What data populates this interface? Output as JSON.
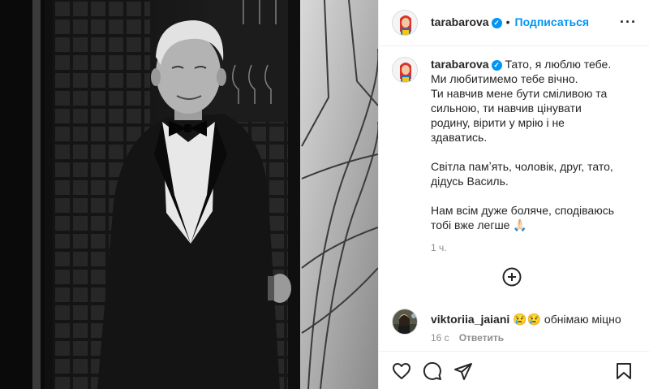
{
  "post": {
    "author": {
      "username": "tarabarova",
      "verified_mark": "✓",
      "follow_label": "Подписаться",
      "separator": "•",
      "more_label": "···"
    },
    "caption": {
      "paragraph_1": "Тато, я люблю тебе.\nМи любитимемо тебе вічно.\nТи навчив мене бути сміливою та\nсильною, ти навчив цінувати\nродину, вірити у мрію і не\nздаватись.",
      "paragraph_2": "Світла памʼять, чоловік, друг, тато,\nдідусь Василь.",
      "paragraph_3": "Нам всім дуже боляче, сподіваюсь\nтобі вже легше 🙏🏻",
      "time": "1 ч."
    },
    "comments": [
      {
        "username": "viktoriia_jaiani",
        "text": "😢😢 обнімаю міцно",
        "time": "16 с",
        "reply_label": "Ответить"
      }
    ],
    "icons": {
      "like": "heart-icon",
      "comment": "comment-icon",
      "share": "share-icon",
      "save": "bookmark-icon",
      "add_comment": "plus-circle-icon"
    },
    "colors": {
      "accent": "#0095f6",
      "text": "#262626",
      "secondary": "#8e8e8e"
    }
  }
}
